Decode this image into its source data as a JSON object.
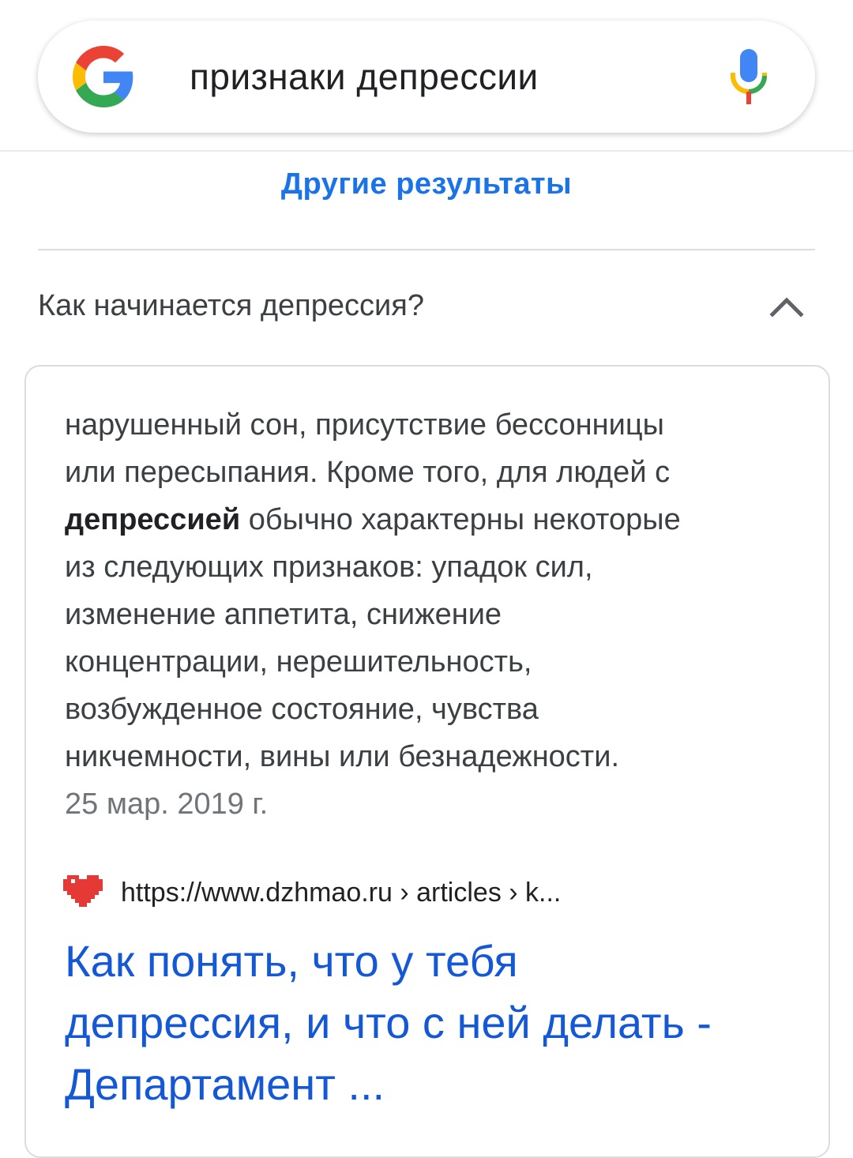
{
  "search": {
    "query": "признаки депрессии"
  },
  "icons": {
    "logo": "google-g-icon",
    "mic": "microphone-icon",
    "chevron": "chevron-up-icon",
    "favicon": "heart-favicon-icon"
  },
  "colors": {
    "link_blue": "#1a73e8",
    "title_blue": "#1558d6",
    "text": "#3c4043",
    "muted": "#70757a"
  },
  "more_results_label": "Другие результаты",
  "related_question": {
    "question": "Как начинается депрессия?",
    "expanded": true,
    "answer": {
      "lines": [
        {
          "before": "нарушенный сон, присутствие бессонницы",
          "bold": "",
          "after": ""
        },
        {
          "before": "или пересыпания. Кроме того, для людей с",
          "bold": "",
          "after": ""
        },
        {
          "before": "",
          "bold": "депрессией",
          "after": " обычно характерны некоторые"
        },
        {
          "before": "из следующих признаков: упадок сил,",
          "bold": "",
          "after": ""
        },
        {
          "before": "изменение аппетита, снижение",
          "bold": "",
          "after": ""
        },
        {
          "before": "концентрации, нерешительность,",
          "bold": "",
          "after": ""
        },
        {
          "before": "возбужденное состояние, чувства",
          "bold": "",
          "after": ""
        },
        {
          "before": "никчемности, вины или безнадежности.",
          "bold": "",
          "after": ""
        }
      ],
      "date": "25 мар. 2019 г.",
      "source_url": "https://www.dzhmao.ru › articles › k...",
      "title_lines": [
        "Как понять, что у тебя",
        "депрессия, и что с ней делать -",
        "Департамент ..."
      ]
    }
  }
}
